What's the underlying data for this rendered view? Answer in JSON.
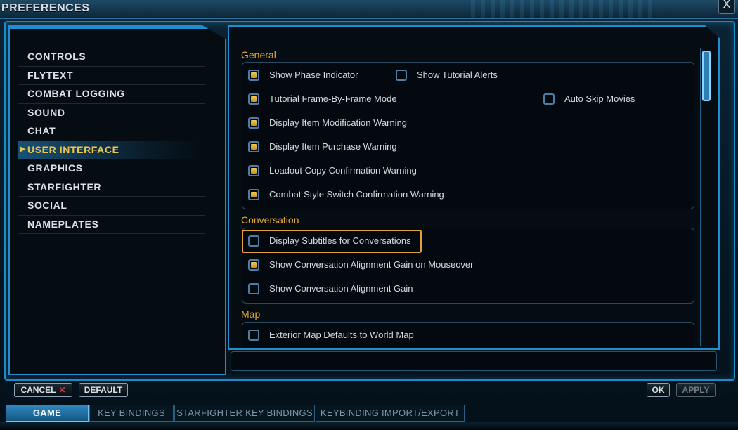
{
  "window": {
    "title": "PREFERENCES",
    "close_glyph": "X"
  },
  "sidebar": {
    "items": [
      {
        "label": "CONTROLS"
      },
      {
        "label": "FLYTEXT"
      },
      {
        "label": "COMBAT LOGGING"
      },
      {
        "label": "SOUND"
      },
      {
        "label": "CHAT"
      },
      {
        "label": "USER INTERFACE",
        "active": true
      },
      {
        "label": "GRAPHICS"
      },
      {
        "label": "STARFIGHTER"
      },
      {
        "label": "SOCIAL"
      },
      {
        "label": "NAMEPLATES"
      }
    ]
  },
  "sections": {
    "general": {
      "title": "General",
      "options": [
        {
          "label": "Show Phase Indicator",
          "checked": true
        },
        {
          "label": "Show Tutorial Alerts",
          "checked": false
        },
        {
          "label": "Tutorial Frame-By-Frame Mode",
          "checked": true
        },
        {
          "label": "Auto Skip Movies",
          "checked": false
        },
        {
          "label": "Display Item Modification Warning",
          "checked": true
        },
        {
          "label": "Display Item Purchase Warning",
          "checked": true
        },
        {
          "label": "Loadout Copy Confirmation Warning",
          "checked": true
        },
        {
          "label": "Combat Style Switch Confirmation Warning",
          "checked": true
        }
      ]
    },
    "conversation": {
      "title": "Conversation",
      "options": [
        {
          "label": "Display Subtitles for Conversations",
          "checked": false
        },
        {
          "label": "Show Conversation Alignment Gain on Mouseover",
          "checked": true
        },
        {
          "label": "Show Conversation Alignment Gain",
          "checked": false
        }
      ]
    },
    "map": {
      "title": "Map",
      "options": [
        {
          "label": "Exterior Map Defaults to World Map",
          "checked": false
        }
      ]
    }
  },
  "buttons": {
    "cancel": "CANCEL",
    "cancel_glyph": "✕",
    "default": "DEFAULT",
    "ok": "OK",
    "apply": "APPLY"
  },
  "tabs": [
    {
      "label": "GAME",
      "active": true
    },
    {
      "label": "KEY BINDINGS"
    },
    {
      "label": "STARFIGHTER KEY BINDINGS"
    },
    {
      "label": "KEYBINDING IMPORT/EXPORT"
    }
  ],
  "colors": {
    "accent": "#1d8fcf",
    "active_text": "#f0c64a",
    "section_title": "#e4a93a",
    "highlight_border": "#e2a23a",
    "check_fill": "#e0aa3a"
  }
}
